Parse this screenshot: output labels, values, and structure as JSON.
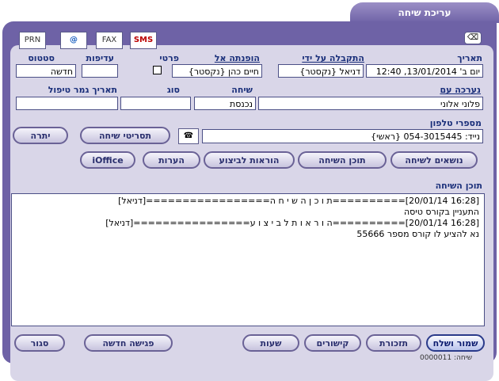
{
  "window": {
    "tab_title": "עריכת שיחה"
  },
  "toolbar": {
    "sms": "SMS",
    "email": "@",
    "fax": "FAX",
    "print": "PRN",
    "eraser": "⌫"
  },
  "fields": {
    "date_label": "תאריך",
    "date_value": "יום ב' 13/01/2014, 12:40",
    "received_by_label": "התקבלה על ידי",
    "received_by_value": "דניאל {נקסטר}",
    "referred_to_label": "הופנתה אל",
    "referred_to_value": "חיים כהן {נקסטר}",
    "private_label": "פרטי",
    "priority_label": "עדיפות",
    "priority_value": "",
    "status_label": "סטטוס",
    "status_value": "חדשה",
    "conducted_with_label": "נערכה עם",
    "conducted_with_value": "פלוני אלוני",
    "call_label": "שיחה",
    "call_value": "נכנסת",
    "type_label": "סוג",
    "type_value": "",
    "treatment_end_label": "תאריך גמר טיפול",
    "treatment_end_value": "",
    "phones_label": "מספרי טלפון",
    "phone_value": "נייד: 054-3015445 {ראשי}"
  },
  "buttons": {
    "call_scripts": "תסריטי שיחה",
    "balance": "יתרה",
    "call_topics": "נושאים לשיחה",
    "call_content": "תוכן השיחה",
    "instructions": "הוראות לביצוע",
    "notes": "הערות",
    "ioffice": "iOffice"
  },
  "content": {
    "label": "תוכן השיחה",
    "lines": [
      "[16:28 20/01/14]==========ת ו כ ן   ה ש י ח ה=================[דניאל]",
      "התעניין בקורס טיסה",
      "[16:28 20/01/14]==========ה ו ר א ו ת   ל ב י צ ו ע================[דניאל]",
      "נא להציע לו קורס מספר 55666",
      "",
      "",
      "",
      "",
      "",
      ""
    ]
  },
  "footer": {
    "save_send": "שמור ושלח",
    "reminders": "תזכורת",
    "links": "קישורים",
    "hours": "שעות",
    "new_meeting": "פגישה חדשה",
    "close": "סגור",
    "status_text": "שיחה: 0000011"
  }
}
